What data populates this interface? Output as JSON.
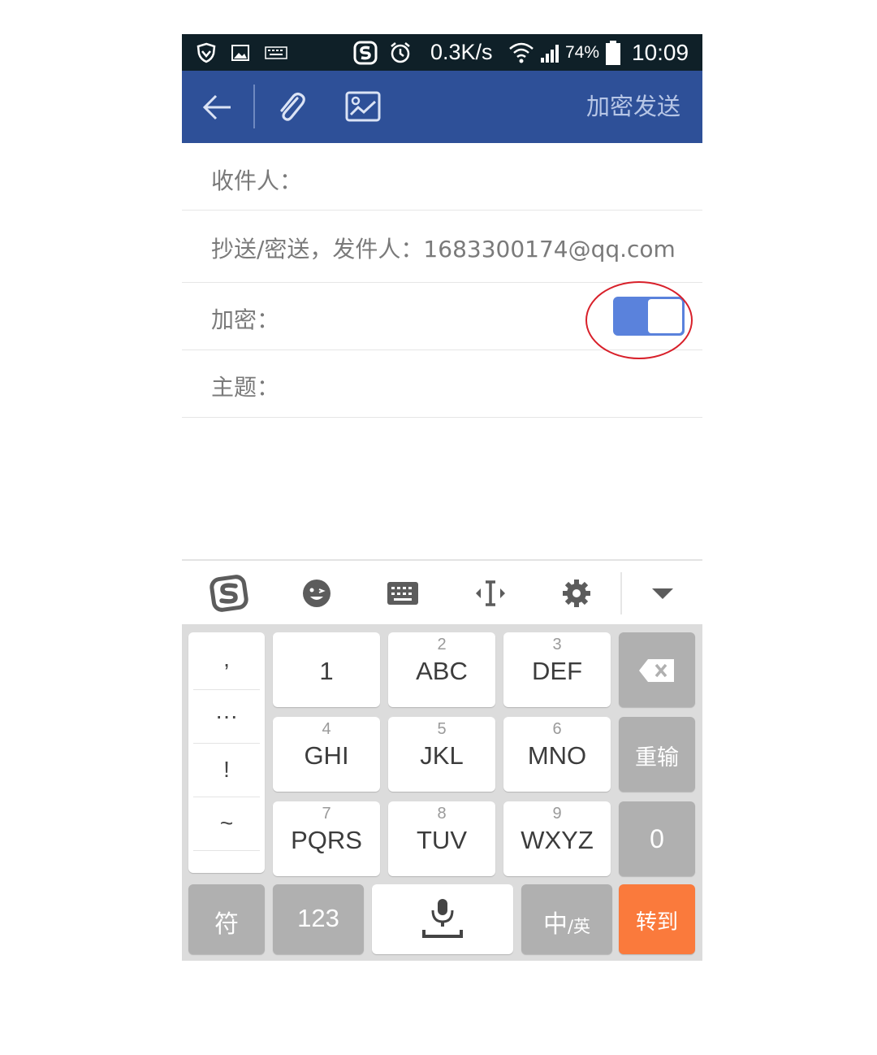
{
  "status_bar": {
    "network_speed": "0.3K/s",
    "battery": "74%",
    "time": "10:09",
    "icons": [
      "shield-icon",
      "image-icon",
      "keyboard-icon",
      "sogou-icon",
      "alarm-icon",
      "wifi-icon",
      "signal-icon",
      "battery-icon"
    ]
  },
  "app_bar": {
    "send_encrypted_label": "加密发送",
    "icons": [
      "back-arrow-icon",
      "attachment-icon",
      "image-icon"
    ]
  },
  "form": {
    "to_label": "收件人：",
    "cc_label": "抄送/密送，发件人：1683300174@qq.com",
    "encrypt_label": "加密：",
    "encrypt_enabled": true,
    "subject_label": "主题："
  },
  "keyboard_toolbar": {
    "icons": [
      "sogou-logo-icon",
      "emoji-icon",
      "keyboard-icon",
      "cursor-icon",
      "settings-icon",
      "collapse-icon"
    ]
  },
  "keyboard": {
    "punct": [
      ",",
      "···",
      "!",
      "~"
    ],
    "keys": [
      {
        "num": "",
        "main": "1"
      },
      {
        "num": "2",
        "main": "ABC"
      },
      {
        "num": "3",
        "main": "DEF"
      },
      {
        "num": "4",
        "main": "GHI"
      },
      {
        "num": "5",
        "main": "JKL"
      },
      {
        "num": "6",
        "main": "MNO"
      },
      {
        "num": "7",
        "main": "PQRS"
      },
      {
        "num": "8",
        "main": "TUV"
      },
      {
        "num": "9",
        "main": "WXYZ"
      }
    ],
    "reinput_label": "重输",
    "zero_label": "0",
    "symbol_label": "符",
    "numbers_label": "123",
    "lang_main": "中",
    "lang_alt": "/英",
    "goto_label": "转到",
    "colors": {
      "accent": "#2e5098",
      "goto": "#fa7a3c",
      "toggle": "#5a82dc",
      "highlight": "#d8202a"
    }
  }
}
